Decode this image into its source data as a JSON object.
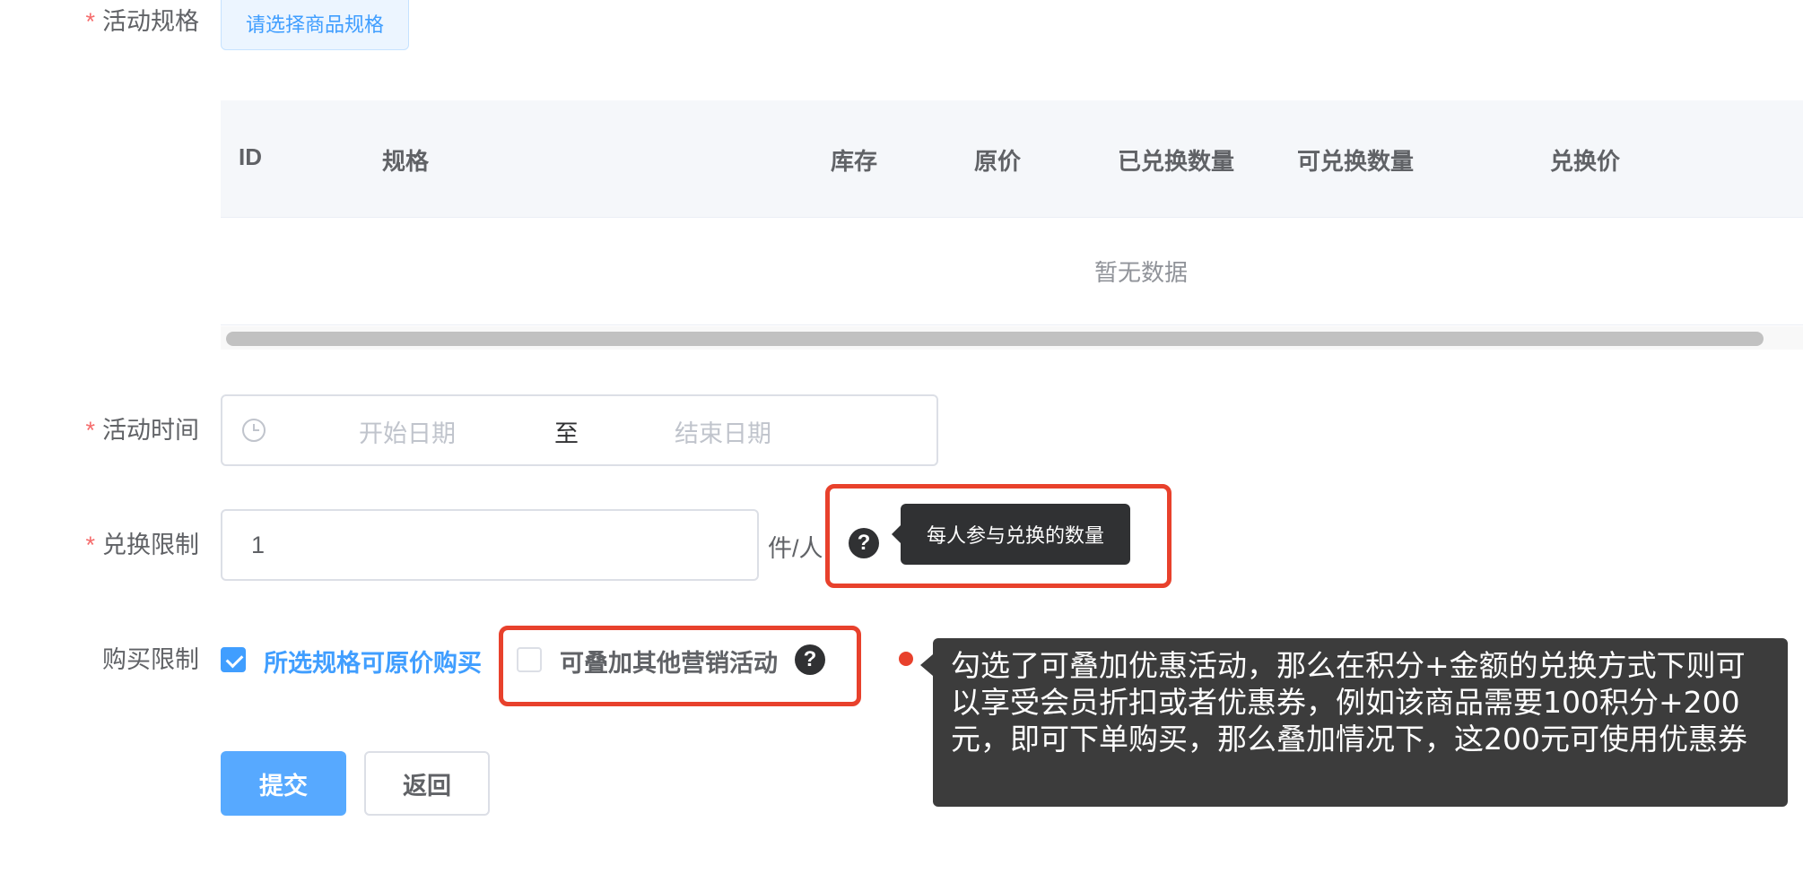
{
  "form": {
    "spec": {
      "required_mark": "*",
      "label": "活动规格",
      "button_label": "请选择商品规格"
    },
    "table": {
      "columns": [
        "ID",
        "规格",
        "库存",
        "原价",
        "已兑换数量",
        "可兑换数量",
        "兑换价"
      ],
      "empty_text": "暂无数据"
    },
    "time": {
      "required_mark": "*",
      "label": "活动时间",
      "start_placeholder": "开始日期",
      "separator": "至",
      "end_placeholder": "结束日期"
    },
    "limit": {
      "required_mark": "*",
      "label": "兑换限制",
      "value": "1",
      "unit": "件/人",
      "help_icon": "question-circle-icon",
      "tooltip": "每人参与兑换的数量"
    },
    "purchase": {
      "label": "购买限制",
      "option_original": "所选规格可原价购买",
      "option_original_checked": true,
      "option_stack": "可叠加其他营销活动",
      "option_stack_checked": false,
      "help_icon": "question-circle-icon",
      "tooltip": "勾选了可叠加优惠活动，那么在积分+金额的兑换方式下则可以享受会员折扣或者优惠券，例如该商品需要100积分+200元，即可下单购买，那么叠加情况下，这200元可使用优惠券"
    },
    "actions": {
      "submit": "提交",
      "back": "返回"
    }
  },
  "colors": {
    "primary": "#409eff",
    "required": "#f56c6c",
    "annotation": "#e8412c",
    "tooltip_bg": "#303133"
  }
}
